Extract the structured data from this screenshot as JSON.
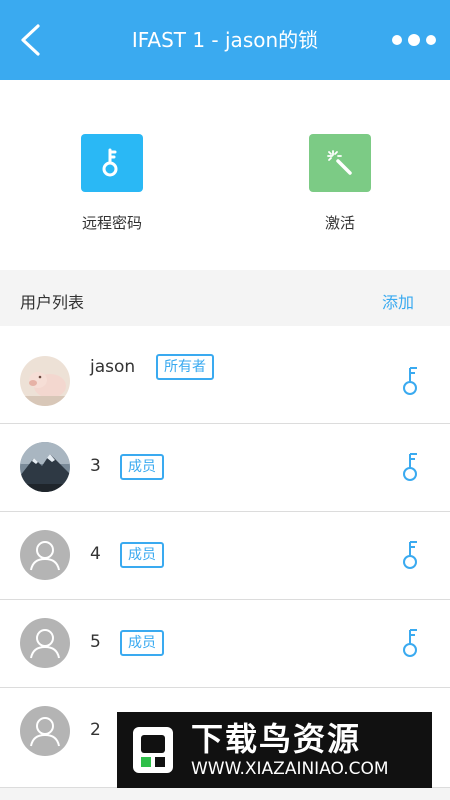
{
  "header": {
    "title": "IFAST 1 - jason的锁",
    "back_icon": "chevron-left-icon",
    "more_icon": "more-dots-icon",
    "color": "#3aaaf0"
  },
  "actions": [
    {
      "label": "远程密码",
      "icon": "key-icon",
      "color": "#2ab8f5"
    },
    {
      "label": "激活",
      "icon": "magic-wand-icon",
      "color": "#7ccb85"
    }
  ],
  "user_list": {
    "title": "用户列表",
    "add_label": "添加",
    "users": [
      {
        "name": "jason",
        "role": "所有者",
        "avatar": "photo-pig"
      },
      {
        "name": "3",
        "role": "成员",
        "avatar": "photo-mountain"
      },
      {
        "name": "4",
        "role": "成员",
        "avatar": "default-person"
      },
      {
        "name": "5",
        "role": "成员",
        "avatar": "default-person"
      },
      {
        "name": "2",
        "role": "",
        "avatar": "default-person"
      }
    ]
  },
  "watermark": {
    "title": "下载鸟资源",
    "url": "WWW.XIAZAINIAO.COM"
  }
}
